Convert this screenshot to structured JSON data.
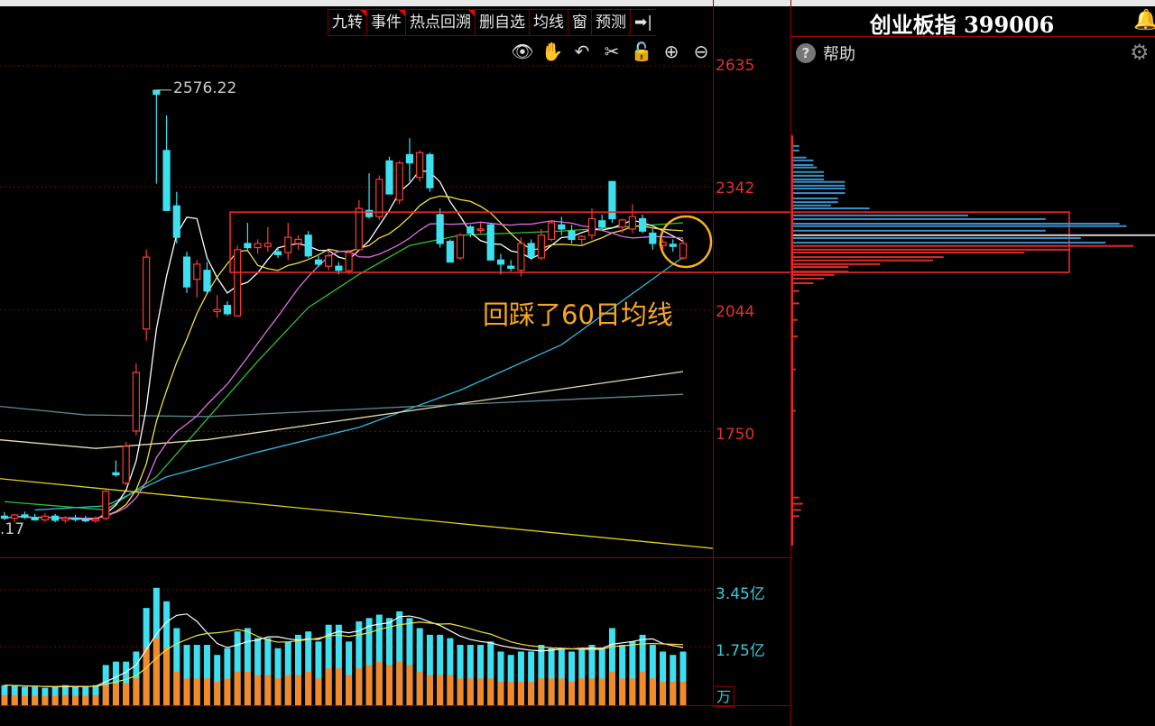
{
  "toolbar": {
    "buttons": [
      {
        "label": "九转",
        "flag": true
      },
      {
        "label": "事件",
        "flag": true
      },
      {
        "label": "热点回溯",
        "flag": true
      },
      {
        "label": "删自选",
        "flag": false
      },
      {
        "label": "均线",
        "flag": false
      },
      {
        "label": "窗",
        "flag": false
      },
      {
        "label": "预测",
        "flag": false
      },
      {
        "label": "➡|",
        "flag": false
      }
    ],
    "tools": [
      "eye-icon",
      "hand-icon",
      "undo-icon",
      "scissors-icon",
      "lock-icon",
      "zoom-in-icon",
      "zoom-out-icon"
    ]
  },
  "header": {
    "title": "创业板指 399006",
    "bell_icon": "bell-icon"
  },
  "side_panel": {
    "help_label": "帮助",
    "help_icon": "question-icon",
    "gear_icon": "gear-icon"
  },
  "annotation": {
    "text": "回踩了60日均线",
    "color": "#f5a623"
  },
  "colors": {
    "up": "#ff3b30",
    "down": "#3ee0f0",
    "grid": "#8a0000",
    "box": "#ff2a2a",
    "circle": "#f5b020",
    "vol_lower": "#f28a2c"
  },
  "chart_data": [
    {
      "type": "candlestick",
      "price_axis": {
        "ticks": [
          "2635",
          "2342",
          "2044",
          "1750"
        ],
        "tick_values": [
          2635,
          2342,
          2044,
          1750
        ]
      },
      "high_label": "2576.22",
      "low_label": ".17",
      "ohlc": [
        [
          1545,
          1555,
          1535,
          1540
        ],
        [
          1540,
          1550,
          1530,
          1548
        ],
        [
          1548,
          1556,
          1538,
          1542
        ],
        [
          1542,
          1550,
          1534,
          1536
        ],
        [
          1536,
          1552,
          1532,
          1545
        ],
        [
          1545,
          1550,
          1530,
          1535
        ],
        [
          1535,
          1545,
          1528,
          1540
        ],
        [
          1540,
          1548,
          1532,
          1537
        ],
        [
          1537,
          1546,
          1530,
          1534
        ],
        [
          1534,
          1545,
          1528,
          1538
        ],
        [
          1540,
          1610,
          1535,
          1605
        ],
        [
          1650,
          1680,
          1640,
          1645
        ],
        [
          1625,
          1725,
          1620,
          1714
        ],
        [
          1751,
          1915,
          1740,
          1893
        ],
        [
          1998,
          2190,
          1970,
          2172
        ],
        [
          2576,
          2576.22,
          2350,
          2566
        ],
        [
          2430,
          2515,
          2300,
          2285
        ],
        [
          2296,
          2330,
          2205,
          2220
        ],
        [
          2172,
          2185,
          2085,
          2100
        ],
        [
          2118,
          2165,
          2074,
          2155
        ],
        [
          2140,
          2160,
          2085,
          2090
        ],
        [
          2040,
          2080,
          2025,
          2045
        ],
        [
          2055,
          2065,
          2030,
          2035
        ],
        [
          2030,
          2200,
          2028,
          2190
        ],
        [
          2205,
          2255,
          2185,
          2195
        ],
        [
          2195,
          2215,
          2180,
          2205
        ],
        [
          2198,
          2245,
          2185,
          2205
        ],
        [
          2185,
          2195,
          2170,
          2178
        ],
        [
          2183,
          2255,
          2165,
          2220
        ],
        [
          2205,
          2225,
          2190,
          2215
        ],
        [
          2225,
          2235,
          2170,
          2175
        ],
        [
          2165,
          2175,
          2148,
          2155
        ],
        [
          2150,
          2185,
          2140,
          2175
        ],
        [
          2150,
          2160,
          2130,
          2140
        ],
        [
          2139,
          2190,
          2130,
          2183
        ],
        [
          2190,
          2310,
          2185,
          2290
        ],
        [
          2285,
          2375,
          2265,
          2270
        ],
        [
          2270,
          2370,
          2262,
          2360
        ],
        [
          2405,
          2415,
          2325,
          2325
        ],
        [
          2310,
          2405,
          2300,
          2400
        ],
        [
          2420,
          2460,
          2355,
          2400
        ],
        [
          2365,
          2430,
          2355,
          2425
        ],
        [
          2420,
          2425,
          2330,
          2340
        ],
        [
          2275,
          2290,
          2195,
          2205
        ],
        [
          2210,
          2215,
          2160,
          2160
        ],
        [
          2170,
          2230,
          2165,
          2225
        ],
        [
          2245,
          2250,
          2220,
          2230
        ],
        [
          2237,
          2255,
          2230,
          2240
        ],
        [
          2250,
          2255,
          2165,
          2165
        ],
        [
          2165,
          2180,
          2130,
          2155
        ],
        [
          2150,
          2165,
          2138,
          2145
        ],
        [
          2140,
          2220,
          2125,
          2205
        ],
        [
          2205,
          2215,
          2165,
          2172
        ],
        [
          2170,
          2240,
          2165,
          2225
        ],
        [
          2215,
          2262,
          2210,
          2255
        ],
        [
          2250,
          2270,
          2225,
          2240
        ],
        [
          2235,
          2250,
          2205,
          2215
        ],
        [
          2215,
          2225,
          2200,
          2222
        ],
        [
          2225,
          2290,
          2215,
          2265
        ],
        [
          2260,
          2275,
          2240,
          2245
        ],
        [
          2355,
          2355,
          2255,
          2265
        ],
        [
          2245,
          2265,
          2230,
          2262
        ],
        [
          2240,
          2300,
          2230,
          2270
        ],
        [
          2265,
          2275,
          2230,
          2235
        ],
        [
          2230,
          2240,
          2190,
          2205
        ],
        [
          2200,
          2215,
          2190,
          2208
        ],
        [
          2203,
          2215,
          2185,
          2198
        ],
        [
          2170,
          2215,
          2165,
          2205
        ]
      ],
      "ma_lines": [
        {
          "color": "#ffffff",
          "period": 5
        },
        {
          "color": "#f0e040",
          "period": 10
        },
        {
          "color": "#e070e0",
          "period": 20
        }
      ],
      "long_lines": [
        {
          "color": "#30c030",
          "points": [
            [
              0,
              1580
            ],
            [
              10,
              1560
            ],
            [
              15,
              1640
            ],
            [
              20,
              1780
            ],
            [
              25,
              1920
            ],
            [
              30,
              2050
            ],
            [
              35,
              2130
            ],
            [
              40,
              2200
            ],
            [
              45,
              2225
            ],
            [
              55,
              2235
            ],
            [
              67,
              2255
            ]
          ]
        },
        {
          "color": "#30b8e0",
          "points": [
            [
              3,
              1560
            ],
            [
              10,
              1570
            ],
            [
              16,
              1640
            ],
            [
              25,
              1700
            ],
            [
              35,
              1760
            ],
            [
              45,
              1850
            ],
            [
              55,
              1960
            ],
            [
              67,
              2172
            ]
          ]
        },
        {
          "color": "#e8e0b0",
          "points": [
            [
              -1,
              1731
            ],
            [
              9,
              1709
            ],
            [
              20,
              1730
            ],
            [
              40,
              1800
            ],
            [
              67,
              1895
            ]
          ]
        },
        {
          "color": "#5a8a90",
          "points": [
            [
              -1,
              1812
            ],
            [
              8,
              1790
            ],
            [
              20,
              1786
            ],
            [
              40,
              1810
            ],
            [
              67,
              1840
            ]
          ]
        },
        {
          "color": "#e0d020",
          "points": [
            [
              -1,
              1637
            ],
            [
              70,
              1467
            ]
          ]
        }
      ],
      "box_range": [
        2135,
        2281
      ],
      "circle_index": 67
    },
    {
      "type": "bar",
      "axis": {
        "ticks": [
          "3.45亿",
          "1.75亿"
        ],
        "tick_values": [
          3.45,
          1.75
        ],
        "unit": "万"
      },
      "volume": [
        0.6,
        0.58,
        0.55,
        0.55,
        0.52,
        0.55,
        0.6,
        0.55,
        0.55,
        0.6,
        1.2,
        1.3,
        1.3,
        1.6,
        2.9,
        3.5,
        3.1,
        2.3,
        1.8,
        1.8,
        1.8,
        1.5,
        1.7,
        2.2,
        2.3,
        2.0,
        2.0,
        1.7,
        1.9,
        2.1,
        2.2,
        1.9,
        2.4,
        2.4,
        1.9,
        2.5,
        2.6,
        2.7,
        2.6,
        2.8,
        2.6,
        2.3,
        2.1,
        2.1,
        2.0,
        1.8,
        1.8,
        1.8,
        1.9,
        1.6,
        1.5,
        1.6,
        1.6,
        1.8,
        1.7,
        1.7,
        1.6,
        1.7,
        1.8,
        1.7,
        2.3,
        1.8,
        1.9,
        2.1,
        1.8,
        1.6,
        1.5,
        1.6
      ],
      "volume_lower": [
        0.3,
        0.3,
        0.28,
        0.28,
        0.27,
        0.28,
        0.3,
        0.28,
        0.28,
        0.3,
        0.6,
        0.65,
        0.65,
        0.8,
        1.7,
        2.0,
        1.7,
        1.0,
        0.8,
        0.8,
        0.8,
        0.7,
        0.8,
        1.0,
        1.0,
        0.9,
        0.9,
        0.8,
        0.9,
        0.9,
        1.0,
        0.8,
        1.1,
        1.1,
        0.9,
        1.1,
        1.2,
        1.3,
        1.2,
        1.3,
        1.2,
        1.0,
        0.9,
        0.9,
        0.9,
        0.8,
        0.8,
        0.8,
        0.8,
        0.7,
        0.7,
        0.7,
        0.7,
        0.8,
        0.8,
        0.8,
        0.7,
        0.8,
        0.8,
        0.8,
        1.0,
        0.8,
        0.8,
        1.0,
        0.8,
        0.7,
        0.7,
        0.7
      ],
      "ma_lines": [
        {
          "color": "#ffffff",
          "period": 5
        },
        {
          "color": "#f0e040",
          "period": 10
        }
      ]
    },
    {
      "type": "bar",
      "orientation": "horizontal",
      "rows": [
        {
          "price": 2441,
          "value": 0.02,
          "side": "up"
        },
        {
          "price": 2430,
          "value": 0.02,
          "side": "up"
        },
        {
          "price": 2413,
          "value": 0.04,
          "side": "up"
        },
        {
          "price": 2406,
          "value": 0.06,
          "side": "up"
        },
        {
          "price": 2395,
          "value": 0.06,
          "side": "up"
        },
        {
          "price": 2389,
          "value": 0.07,
          "side": "up"
        },
        {
          "price": 2378,
          "value": 0.09,
          "side": "up"
        },
        {
          "price": 2369,
          "value": 0.09,
          "side": "up"
        },
        {
          "price": 2360,
          "value": 0.09,
          "side": "up"
        },
        {
          "price": 2354,
          "value": 0.15,
          "side": "up"
        },
        {
          "price": 2345,
          "value": 0.15,
          "side": "up"
        },
        {
          "price": 2338,
          "value": 0.15,
          "side": "up"
        },
        {
          "price": 2327,
          "value": 0.15,
          "side": "up"
        },
        {
          "price": 2314,
          "value": 0.13,
          "side": "up"
        },
        {
          "price": 2305,
          "value": 0.13,
          "side": "up"
        },
        {
          "price": 2297,
          "value": 0.11,
          "side": "up"
        },
        {
          "price": 2290,
          "value": 0.22,
          "side": "up"
        },
        {
          "price": 2273,
          "value": 0.5,
          "side": "up"
        },
        {
          "price": 2264,
          "value": 0.72,
          "side": "up"
        },
        {
          "price": 2253,
          "value": 0.93,
          "side": "up"
        },
        {
          "price": 2247,
          "value": 0.95,
          "side": "up"
        },
        {
          "price": 2236,
          "value": 0.72,
          "side": "up"
        },
        {
          "price": 2225,
          "value": 1.0,
          "side": "current"
        },
        {
          "price": 2218,
          "value": 0.82,
          "side": "up"
        },
        {
          "price": 2207,
          "value": 0.89,
          "side": "up"
        },
        {
          "price": 2199,
          "value": 0.97,
          "side": "down"
        },
        {
          "price": 2190,
          "value": 0.79,
          "side": "down"
        },
        {
          "price": 2183,
          "value": 0.66,
          "side": "down"
        },
        {
          "price": 2172,
          "value": 0.43,
          "side": "down"
        },
        {
          "price": 2164,
          "value": 0.4,
          "side": "down"
        },
        {
          "price": 2155,
          "value": 0.25,
          "side": "down"
        },
        {
          "price": 2148,
          "value": 0.16,
          "side": "down"
        },
        {
          "price": 2137,
          "value": 0.16,
          "side": "down"
        },
        {
          "price": 2129,
          "value": 0.12,
          "side": "down"
        },
        {
          "price": 2120,
          "value": 0.09,
          "side": "down"
        },
        {
          "price": 2109,
          "value": 0.06,
          "side": "down"
        },
        {
          "price": 2090,
          "value": 0.02,
          "side": "down"
        },
        {
          "price": 2060,
          "value": 0.02,
          "side": "down"
        },
        {
          "price": 2020,
          "value": 0.015,
          "side": "down"
        },
        {
          "price": 1980,
          "value": 0.015,
          "side": "down"
        },
        {
          "price": 1900,
          "value": 0.01,
          "side": "down"
        },
        {
          "price": 1800,
          "value": 0.01,
          "side": "down"
        },
        {
          "price": 1590,
          "value": 0.02,
          "side": "down"
        },
        {
          "price": 1575,
          "value": 0.03,
          "side": "down"
        },
        {
          "price": 1560,
          "value": 0.025,
          "side": "down"
        },
        {
          "price": 1545,
          "value": 0.02,
          "side": "down"
        }
      ]
    }
  ]
}
